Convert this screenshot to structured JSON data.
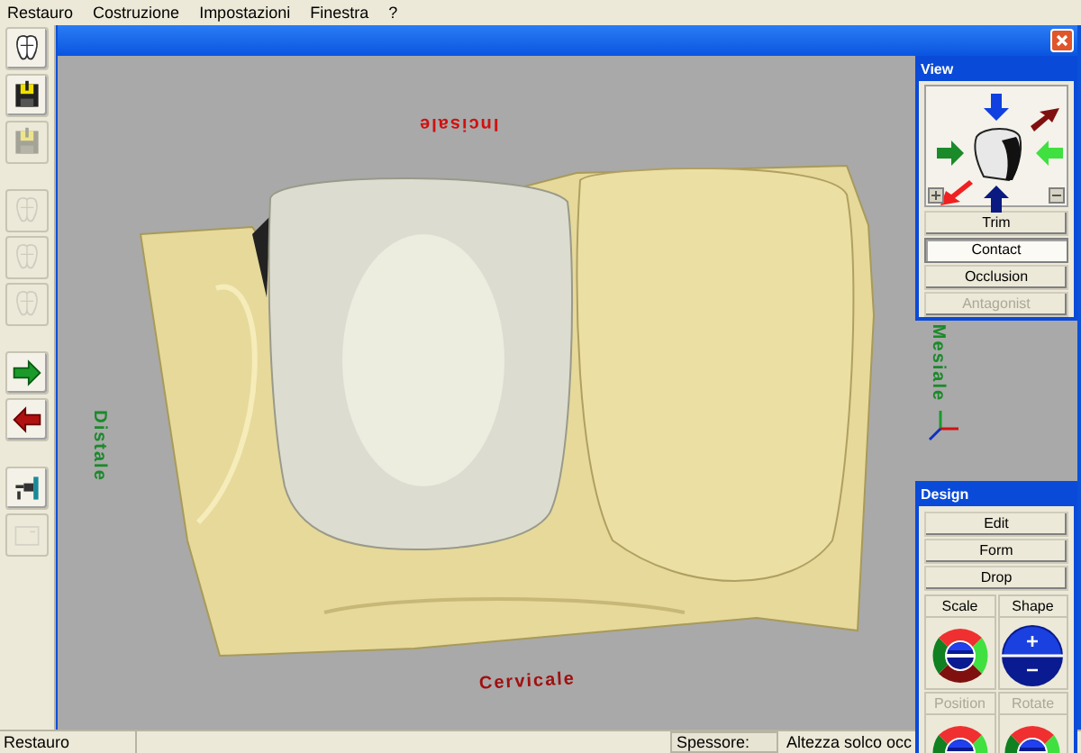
{
  "menu": [
    "Restauro",
    "Costruzione",
    "Impostazioni",
    "Finestra",
    "?"
  ],
  "toolbar": [
    [
      {
        "kind": "tooth",
        "disabled": false
      },
      {
        "kind": "save",
        "disabled": false
      },
      {
        "kind": "save",
        "disabled": true
      }
    ],
    [
      {
        "kind": "tooth-outline",
        "disabled": true
      },
      {
        "kind": "tooth-outline",
        "disabled": true
      },
      {
        "kind": "tooth-outline",
        "disabled": true
      }
    ],
    [
      {
        "kind": "arrow-right",
        "disabled": false
      },
      {
        "kind": "arrow-left",
        "disabled": false
      }
    ],
    [
      {
        "kind": "tool",
        "disabled": false
      },
      {
        "kind": "card",
        "disabled": true
      }
    ]
  ],
  "viewport": {
    "labels": [
      {
        "kind": "top",
        "text": "Incisale"
      },
      {
        "kind": "left",
        "text": "Distale"
      },
      {
        "kind": "right",
        "text": "Mesiale"
      },
      {
        "kind": "bottom",
        "text": "Cervicale"
      }
    ]
  },
  "view_panel": {
    "title": "View",
    "buttons": [
      {
        "label": "Trim",
        "selected": false,
        "disabled": false
      },
      {
        "label": "Contact",
        "selected": true,
        "disabled": false
      },
      {
        "label": "Occlusion",
        "selected": false,
        "disabled": false
      },
      {
        "label": "Antagonist",
        "selected": false,
        "disabled": true
      }
    ]
  },
  "design_panel": {
    "title": "Design",
    "buttons": [
      {
        "label": "Edit",
        "disabled": false
      },
      {
        "label": "Form",
        "disabled": false
      },
      {
        "label": "Drop",
        "disabled": false
      }
    ],
    "tools": [
      {
        "label": "Scale",
        "kind": "ring",
        "disabled": false
      },
      {
        "label": "Shape",
        "kind": "plus-minus",
        "disabled": false
      },
      {
        "label": "Position",
        "kind": "ring",
        "disabled": true
      },
      {
        "label": "Rotate",
        "kind": "ring",
        "disabled": true
      }
    ]
  },
  "status_bar": [
    "Restauro",
    "Spessore:",
    "Altezza solco occ"
  ]
}
